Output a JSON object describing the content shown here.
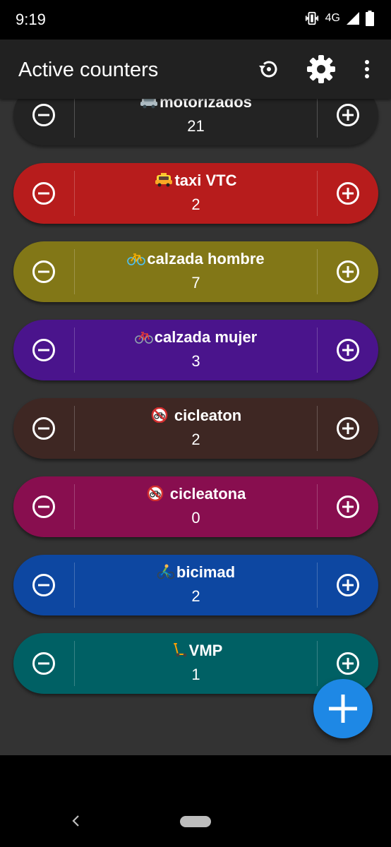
{
  "status_bar": {
    "time": "9:19",
    "network": "4G",
    "icons": [
      "vibrate-icon",
      "signal-icon",
      "battery-icon"
    ]
  },
  "app_bar": {
    "title": "Active counters",
    "actions": [
      "history-icon",
      "gear-icon",
      "more-vert-icon"
    ]
  },
  "counters": [
    {
      "emoji": "car",
      "label": "motorizados",
      "count": "21",
      "color": "#232323"
    },
    {
      "emoji": "taxi",
      "label": "taxi VTC",
      "count": "2",
      "color": "#b71c1c"
    },
    {
      "emoji": "bicycle",
      "label": "calzada hombre",
      "count": "7",
      "color": "#827717"
    },
    {
      "emoji": "bicycle",
      "label": "calzada mujer",
      "count": "3",
      "color": "#4a148c"
    },
    {
      "emoji": "no-bicycles",
      "label": "cicleaton",
      "count": "2",
      "color": "#3e2723"
    },
    {
      "emoji": "no-bicycles",
      "label": "cicleatona",
      "count": "0",
      "color": "#880e4f"
    },
    {
      "emoji": "person-biking",
      "label": "bicimad",
      "count": "2",
      "color": "#0d47a1"
    },
    {
      "emoji": "scooter",
      "label": "VMP",
      "count": "1",
      "color": "#006064"
    }
  ],
  "fab": {
    "icon": "plus-icon",
    "color": "#1e88e5"
  },
  "nav_bar": {
    "icons": [
      "back-icon",
      "home-pill"
    ]
  }
}
